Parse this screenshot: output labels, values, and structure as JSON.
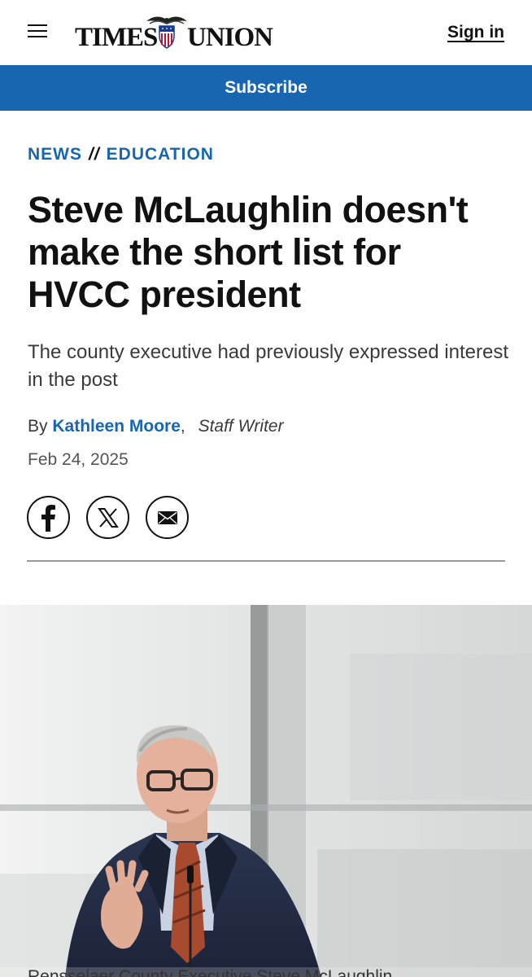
{
  "header": {
    "logo_left": "TIMES",
    "logo_right": "UNION",
    "sign_in": "Sign in",
    "menu_icon": "hamburger-menu-icon"
  },
  "subscribe": {
    "label": "Subscribe",
    "color": "#1866b0"
  },
  "breadcrumb": {
    "section": "NEWS",
    "separator": "//",
    "subsection": "EDUCATION"
  },
  "article": {
    "headline": "Steve McLaughlin doesn't make the short list for HVCC president",
    "subhead": "The county executive had previously expressed interest in the post",
    "byline_prefix": "By",
    "author": "Kathleen Moore",
    "author_role": "Staff Writer",
    "date": "Feb 24, 2025"
  },
  "share": {
    "icons": [
      "facebook-icon",
      "x-icon",
      "email-icon"
    ]
  },
  "photo": {
    "subject": "man-in-suit-and-glasses-speaking-photo"
  },
  "caption": {
    "visible_text": "Rensselaer County Executive Steve McLaughlin"
  },
  "colors": {
    "accent": "#1866b0",
    "text": "#111111"
  }
}
